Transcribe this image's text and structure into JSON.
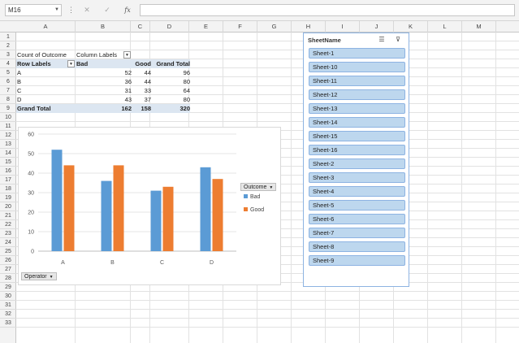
{
  "formula_bar": {
    "name_box": "M16",
    "more_icon": "dots-vertical",
    "cancel_icon": "✕",
    "enter_icon": "✓",
    "fx_label": "fx",
    "formula": ""
  },
  "columns": [
    "A",
    "B",
    "C",
    "D",
    "E",
    "F",
    "G",
    "H",
    "I",
    "J",
    "K",
    "L",
    "M"
  ],
  "rows": [
    "1",
    "2",
    "3",
    "4",
    "5",
    "6",
    "7",
    "8",
    "9",
    "10",
    "11",
    "12",
    "13",
    "14",
    "15",
    "16",
    "17",
    "18",
    "19",
    "20",
    "21",
    "22",
    "23",
    "24",
    "25",
    "26",
    "27",
    "28",
    "29",
    "30",
    "31",
    "32",
    "33"
  ],
  "pivot": {
    "values_label": "Count of Outcome",
    "columns_label": "Column Labels",
    "rows_label": "Row Labels",
    "col_headers": [
      "Bad",
      "Good",
      "Grand Total"
    ],
    "rows": [
      {
        "label": "A",
        "bad": "52",
        "good": "44",
        "total": "96"
      },
      {
        "label": "B",
        "bad": "36",
        "good": "44",
        "total": "80"
      },
      {
        "label": "C",
        "bad": "31",
        "good": "33",
        "total": "64"
      },
      {
        "label": "D",
        "bad": "43",
        "good": "37",
        "total": "80"
      }
    ],
    "grand_total": {
      "label": "Grand Total",
      "bad": "162",
      "good": "158",
      "total": "320"
    },
    "header_band_color": "#dce6f1"
  },
  "chart_data": {
    "type": "bar",
    "categories": [
      "A",
      "B",
      "C",
      "D"
    ],
    "series": [
      {
        "name": "Bad",
        "values": [
          52,
          36,
          31,
          43
        ],
        "color": "#5b9bd5"
      },
      {
        "name": "Good",
        "values": [
          44,
          44,
          33,
          37
        ],
        "color": "#ed7d31"
      }
    ],
    "ylim": [
      0,
      60
    ],
    "yticks": [
      "0",
      "10",
      "20",
      "30",
      "40",
      "50",
      "60"
    ],
    "grid": true,
    "legend_title": "Outcome",
    "legend_position": "right",
    "axis_field": "Operator"
  },
  "slicer": {
    "title": "SheetName",
    "multiselect_icon": "multi-select-icon",
    "clear_filter_icon": "clear-filter-icon",
    "items": [
      "Sheet-1",
      "Sheet-10",
      "Sheet-11",
      "Sheet-12",
      "Sheet-13",
      "Sheet-14",
      "Sheet-15",
      "Sheet-16",
      "Sheet-2",
      "Sheet-3",
      "Sheet-4",
      "Sheet-5",
      "Sheet-6",
      "Sheet-7",
      "Sheet-8",
      "Sheet-9"
    ],
    "item_color": "#bdd7ee",
    "border_color": "#8db3e2"
  }
}
